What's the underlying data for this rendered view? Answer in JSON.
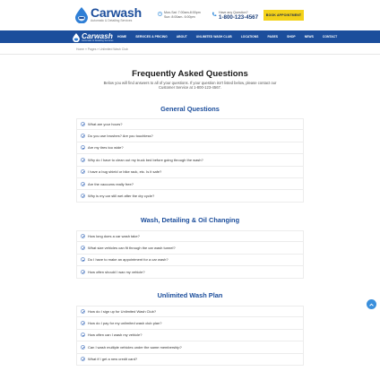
{
  "colors": {
    "brand": "#1c4e9c",
    "accent": "#f4d219",
    "nav_bg": "#1c4e9c",
    "scroll_btn": "#3a8fdc"
  },
  "header": {
    "logo_name": "Carwash",
    "logo_tagline": "Automatic & Detailing Services",
    "hours_line1": "Mon-Sat: 7:00am-8:00pm",
    "hours_line2": "Sun: 8:00am- 6:00pm",
    "contact_question": "Have any Question?",
    "phone": "1-800-123-4567",
    "book_button": "BOOK APPOINTMENT"
  },
  "nav": {
    "logo_name": "Carwash",
    "logo_tagline": "Automatic & Detailing Services",
    "items": [
      "HOME",
      "SERVICES & PRICING",
      "ABOUT",
      "UNLIMITED WASH CLUB",
      "LOCATIONS",
      "PAGES",
      "SHOP",
      "NEWS",
      "CONTACT"
    ]
  },
  "breadcrumb": "Home  »  Pages  »  Unlimited Wash Club",
  "main": {
    "title": "Frequently Asked Questions",
    "intro": "Below you will find answers to all of your questions. If your question isn't listed below, please contact our Customer Service at 1-800-123-4567."
  },
  "sections": [
    {
      "title": "General Questions",
      "questions": [
        "What are your hours?",
        "Do you use brushes? Are you touchless?",
        "Are my tires too wide?",
        "Why do I have to clean out my truck bed before going through the wash?",
        "I have a bug shield or bike rack, etc. Is it safe?",
        "Are the vacuums really free?",
        "Why is my car still wet after the dry cycle?"
      ]
    },
    {
      "title": "Wash, Detailing & Oil Changing",
      "questions": [
        "How long does a car wash take?",
        "What size vehicles can fit through the car wash tunnel?",
        "Do I have to make an appointment for a car wash?",
        "How often should I wax my vehicle?"
      ]
    },
    {
      "title": "Unlimited Wash Plan",
      "questions": [
        "How do I sign up for Unlimited Wash Club?",
        "How do I pay for my unlimited wash club plan?",
        "How often can I wash my vehicle?",
        "Can I wash multiple vehicles under the same membership?",
        "What if I get a new credit card?"
      ]
    }
  ]
}
